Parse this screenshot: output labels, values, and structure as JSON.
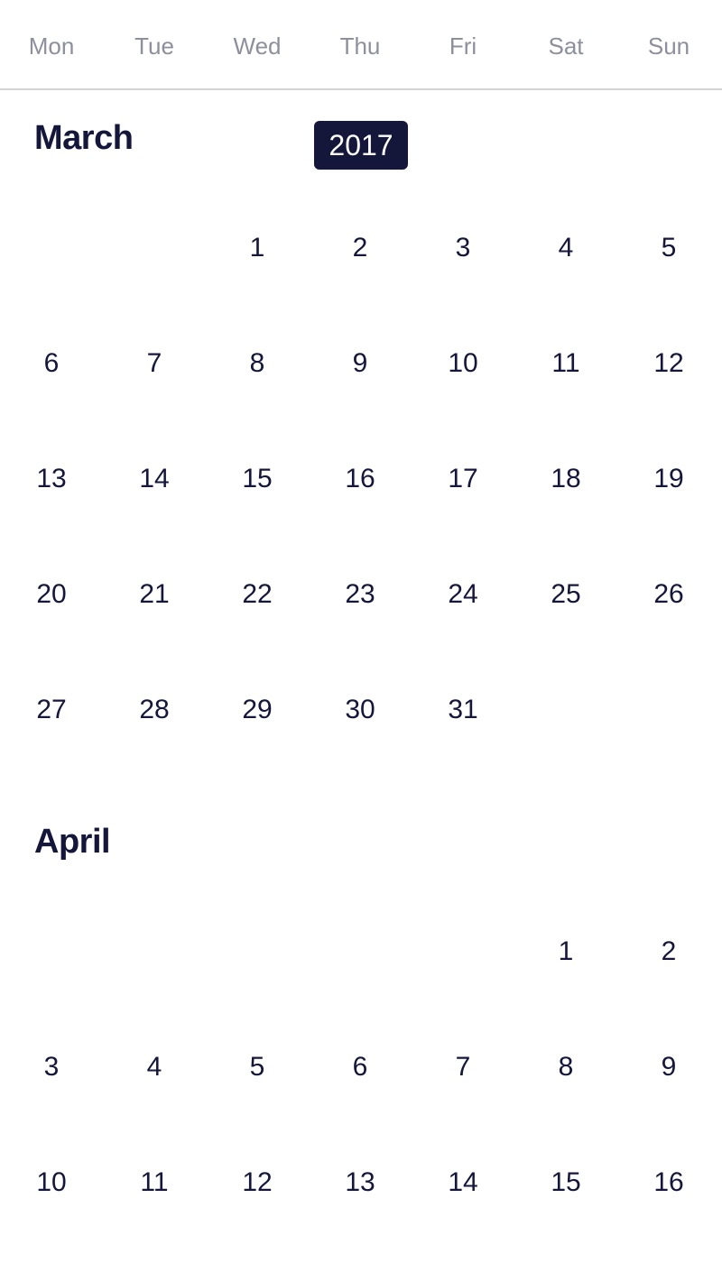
{
  "weekdays": [
    "Mon",
    "Tue",
    "Wed",
    "Thu",
    "Fri",
    "Sat",
    "Sun"
  ],
  "year_badge": "2017",
  "months": [
    {
      "name": "March",
      "weeks": [
        [
          "",
          "",
          "1",
          "2",
          "3",
          "4",
          "5"
        ],
        [
          "6",
          "7",
          "8",
          "9",
          "10",
          "11",
          "12"
        ],
        [
          "13",
          "14",
          "15",
          "16",
          "17",
          "18",
          "19"
        ],
        [
          "20",
          "21",
          "22",
          "23",
          "24",
          "25",
          "26"
        ],
        [
          "27",
          "28",
          "29",
          "30",
          "31",
          "",
          ""
        ]
      ]
    },
    {
      "name": "April",
      "weeks": [
        [
          "",
          "",
          "",
          "",
          "",
          "1",
          "2"
        ],
        [
          "3",
          "4",
          "5",
          "6",
          "7",
          "8",
          "9"
        ],
        [
          "10",
          "11",
          "12",
          "13",
          "14",
          "15",
          "16"
        ]
      ]
    }
  ],
  "colors": {
    "text": "#14163a",
    "weekday_text": "#8d8f9c",
    "badge_bg": "#14163a",
    "badge_text": "#ffffff",
    "divider": "#d4d4d8"
  }
}
